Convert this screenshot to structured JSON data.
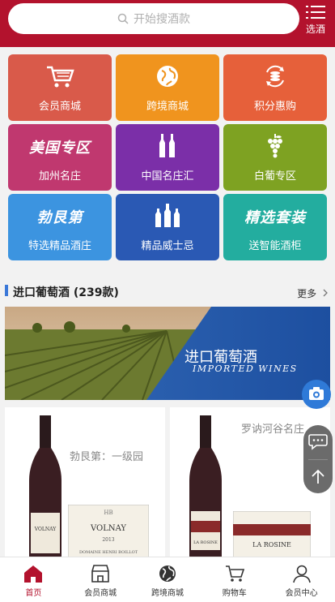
{
  "header": {
    "search_placeholder": "开始搜酒款",
    "filter_label": "选酒",
    "brand_color": "#b3122d"
  },
  "tiles": [
    {
      "label": "会员商城",
      "icon": "shopping-cart-icon",
      "color": "#d95a4a"
    },
    {
      "label": "跨境商城",
      "icon": "globe-icon",
      "color": "#f0941e"
    },
    {
      "label": "积分惠购",
      "icon": "coin-exchange-icon",
      "color": "#e6603a"
    },
    {
      "label": "加州名庄",
      "big": "美国专区",
      "color": "#c0386f"
    },
    {
      "label": "中国名庄汇",
      "icon": "bottles-icon",
      "color": "#7b2fa8"
    },
    {
      "label": "白葡专区",
      "icon": "grapes-icon",
      "color": "#7ea222"
    },
    {
      "label": "特选精品酒庄",
      "big": "勃艮第",
      "color": "#3c94e0"
    },
    {
      "label": "精品威士忌",
      "icon": "whisky-bottles-icon",
      "color": "#2a59b4"
    },
    {
      "label": "送智能酒柜",
      "big": "精选套装",
      "color": "#23ad9f"
    }
  ],
  "section": {
    "title": "进口葡萄酒 (239款)",
    "more": "更多"
  },
  "banner": {
    "title": "进口葡萄酒",
    "subtitle": "IMPORTED WINES"
  },
  "products": [
    {
      "caption": "勃艮第：一级园",
      "label_name": "VOLNAY",
      "label_sub": "DOMAINE HENRI BOILLOT",
      "label_year": "2013"
    },
    {
      "caption": "罗讷河谷名庄",
      "label_name": "LA ROSINE"
    }
  ],
  "tabbar": [
    {
      "label": "首页",
      "icon": "home-icon",
      "active": true
    },
    {
      "label": "会员商城",
      "icon": "store-icon",
      "active": false
    },
    {
      "label": "跨境商城",
      "icon": "globe-icon",
      "active": false
    },
    {
      "label": "购物车",
      "icon": "cart-icon",
      "active": false
    },
    {
      "label": "会员中心",
      "icon": "user-icon",
      "active": false
    }
  ]
}
